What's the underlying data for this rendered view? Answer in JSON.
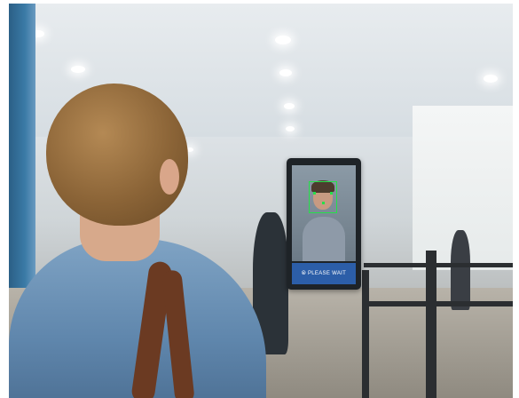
{
  "kiosk": {
    "banner_text": "⦾ PLEASE WAIT",
    "accent_color": "#2c5ea8",
    "face_box_color": "#25e04a"
  }
}
